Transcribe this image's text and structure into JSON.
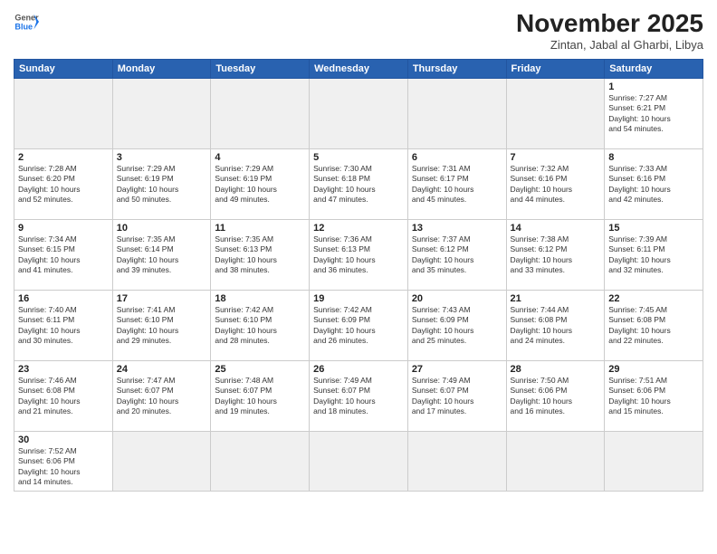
{
  "header": {
    "logo_general": "General",
    "logo_blue": "Blue",
    "month_title": "November 2025",
    "location": "Zintan, Jabal al Gharbi, Libya"
  },
  "days_of_week": [
    "Sunday",
    "Monday",
    "Tuesday",
    "Wednesday",
    "Thursday",
    "Friday",
    "Saturday"
  ],
  "weeks": [
    [
      {
        "day": "",
        "info": ""
      },
      {
        "day": "",
        "info": ""
      },
      {
        "day": "",
        "info": ""
      },
      {
        "day": "",
        "info": ""
      },
      {
        "day": "",
        "info": ""
      },
      {
        "day": "",
        "info": ""
      },
      {
        "day": "1",
        "info": "Sunrise: 7:27 AM\nSunset: 6:21 PM\nDaylight: 10 hours\nand 54 minutes."
      }
    ],
    [
      {
        "day": "2",
        "info": "Sunrise: 7:28 AM\nSunset: 6:20 PM\nDaylight: 10 hours\nand 52 minutes."
      },
      {
        "day": "3",
        "info": "Sunrise: 7:29 AM\nSunset: 6:19 PM\nDaylight: 10 hours\nand 50 minutes."
      },
      {
        "day": "4",
        "info": "Sunrise: 7:29 AM\nSunset: 6:19 PM\nDaylight: 10 hours\nand 49 minutes."
      },
      {
        "day": "5",
        "info": "Sunrise: 7:30 AM\nSunset: 6:18 PM\nDaylight: 10 hours\nand 47 minutes."
      },
      {
        "day": "6",
        "info": "Sunrise: 7:31 AM\nSunset: 6:17 PM\nDaylight: 10 hours\nand 45 minutes."
      },
      {
        "day": "7",
        "info": "Sunrise: 7:32 AM\nSunset: 6:16 PM\nDaylight: 10 hours\nand 44 minutes."
      },
      {
        "day": "8",
        "info": "Sunrise: 7:33 AM\nSunset: 6:16 PM\nDaylight: 10 hours\nand 42 minutes."
      }
    ],
    [
      {
        "day": "9",
        "info": "Sunrise: 7:34 AM\nSunset: 6:15 PM\nDaylight: 10 hours\nand 41 minutes."
      },
      {
        "day": "10",
        "info": "Sunrise: 7:35 AM\nSunset: 6:14 PM\nDaylight: 10 hours\nand 39 minutes."
      },
      {
        "day": "11",
        "info": "Sunrise: 7:35 AM\nSunset: 6:13 PM\nDaylight: 10 hours\nand 38 minutes."
      },
      {
        "day": "12",
        "info": "Sunrise: 7:36 AM\nSunset: 6:13 PM\nDaylight: 10 hours\nand 36 minutes."
      },
      {
        "day": "13",
        "info": "Sunrise: 7:37 AM\nSunset: 6:12 PM\nDaylight: 10 hours\nand 35 minutes."
      },
      {
        "day": "14",
        "info": "Sunrise: 7:38 AM\nSunset: 6:12 PM\nDaylight: 10 hours\nand 33 minutes."
      },
      {
        "day": "15",
        "info": "Sunrise: 7:39 AM\nSunset: 6:11 PM\nDaylight: 10 hours\nand 32 minutes."
      }
    ],
    [
      {
        "day": "16",
        "info": "Sunrise: 7:40 AM\nSunset: 6:11 PM\nDaylight: 10 hours\nand 30 minutes."
      },
      {
        "day": "17",
        "info": "Sunrise: 7:41 AM\nSunset: 6:10 PM\nDaylight: 10 hours\nand 29 minutes."
      },
      {
        "day": "18",
        "info": "Sunrise: 7:42 AM\nSunset: 6:10 PM\nDaylight: 10 hours\nand 28 minutes."
      },
      {
        "day": "19",
        "info": "Sunrise: 7:42 AM\nSunset: 6:09 PM\nDaylight: 10 hours\nand 26 minutes."
      },
      {
        "day": "20",
        "info": "Sunrise: 7:43 AM\nSunset: 6:09 PM\nDaylight: 10 hours\nand 25 minutes."
      },
      {
        "day": "21",
        "info": "Sunrise: 7:44 AM\nSunset: 6:08 PM\nDaylight: 10 hours\nand 24 minutes."
      },
      {
        "day": "22",
        "info": "Sunrise: 7:45 AM\nSunset: 6:08 PM\nDaylight: 10 hours\nand 22 minutes."
      }
    ],
    [
      {
        "day": "23",
        "info": "Sunrise: 7:46 AM\nSunset: 6:08 PM\nDaylight: 10 hours\nand 21 minutes."
      },
      {
        "day": "24",
        "info": "Sunrise: 7:47 AM\nSunset: 6:07 PM\nDaylight: 10 hours\nand 20 minutes."
      },
      {
        "day": "25",
        "info": "Sunrise: 7:48 AM\nSunset: 6:07 PM\nDaylight: 10 hours\nand 19 minutes."
      },
      {
        "day": "26",
        "info": "Sunrise: 7:49 AM\nSunset: 6:07 PM\nDaylight: 10 hours\nand 18 minutes."
      },
      {
        "day": "27",
        "info": "Sunrise: 7:49 AM\nSunset: 6:07 PM\nDaylight: 10 hours\nand 17 minutes."
      },
      {
        "day": "28",
        "info": "Sunrise: 7:50 AM\nSunset: 6:06 PM\nDaylight: 10 hours\nand 16 minutes."
      },
      {
        "day": "29",
        "info": "Sunrise: 7:51 AM\nSunset: 6:06 PM\nDaylight: 10 hours\nand 15 minutes."
      }
    ],
    [
      {
        "day": "30",
        "info": "Sunrise: 7:52 AM\nSunset: 6:06 PM\nDaylight: 10 hours\nand 14 minutes."
      },
      {
        "day": "",
        "info": ""
      },
      {
        "day": "",
        "info": ""
      },
      {
        "day": "",
        "info": ""
      },
      {
        "day": "",
        "info": ""
      },
      {
        "day": "",
        "info": ""
      },
      {
        "day": "",
        "info": ""
      }
    ]
  ]
}
